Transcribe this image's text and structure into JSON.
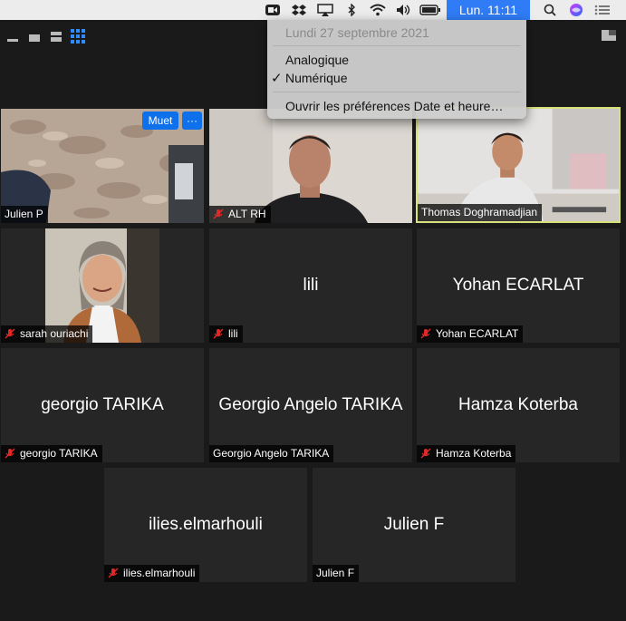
{
  "menubar": {
    "clock": "Lun. 11:11",
    "icons": [
      "zoom-icon",
      "dropbox-icon",
      "airplay-icon",
      "bluetooth-icon",
      "wifi-icon",
      "volume-icon",
      "battery-icon",
      "search-icon",
      "siri-icon",
      "notification-list-icon"
    ]
  },
  "clock_menu": {
    "date": "Lundi 27 septembre 2021",
    "option_analog": "Analogique",
    "option_digital": "Numérique",
    "selected": "Numérique",
    "preferences": "Ouvrir les préférences Date et heure…"
  },
  "tiles": [
    {
      "name": "Julien P",
      "display": "",
      "muted": false,
      "video": true
    },
    {
      "name": "ALT RH",
      "display": "",
      "muted": true,
      "video": true
    },
    {
      "name": "Thomas Doghramadjian",
      "display": "",
      "muted": false,
      "video": true,
      "active_speaker": true
    },
    {
      "name": "sarah ouriachi",
      "display": "",
      "muted": true,
      "video": true
    },
    {
      "name": "lili",
      "display": "lili",
      "muted": true,
      "video": false
    },
    {
      "name": "Yohan ECARLAT",
      "display": "Yohan ECARLAT",
      "muted": true,
      "video": false
    },
    {
      "name": "georgio TARIKA",
      "display": "georgio TARIKA",
      "muted": true,
      "video": false
    },
    {
      "name": "Georgio Angelo TARIKA",
      "display": "Georgio Angelo TARIKA",
      "muted": false,
      "video": false
    },
    {
      "name": "Hamza Koterba",
      "display": "Hamza Koterba",
      "muted": true,
      "video": false
    },
    {
      "name": "ilies.elmarhouli",
      "display": "ilies.elmarhouli",
      "muted": true,
      "video": false
    },
    {
      "name": "Julien F",
      "display": "Julien F",
      "muted": false,
      "video": false
    }
  ],
  "tile_actions": {
    "mute_label": "Muet",
    "more_label": "···"
  },
  "colors": {
    "accent": "#0e71eb",
    "active_speaker_border": "#d8e27a",
    "mic_muted": "#e02828"
  }
}
